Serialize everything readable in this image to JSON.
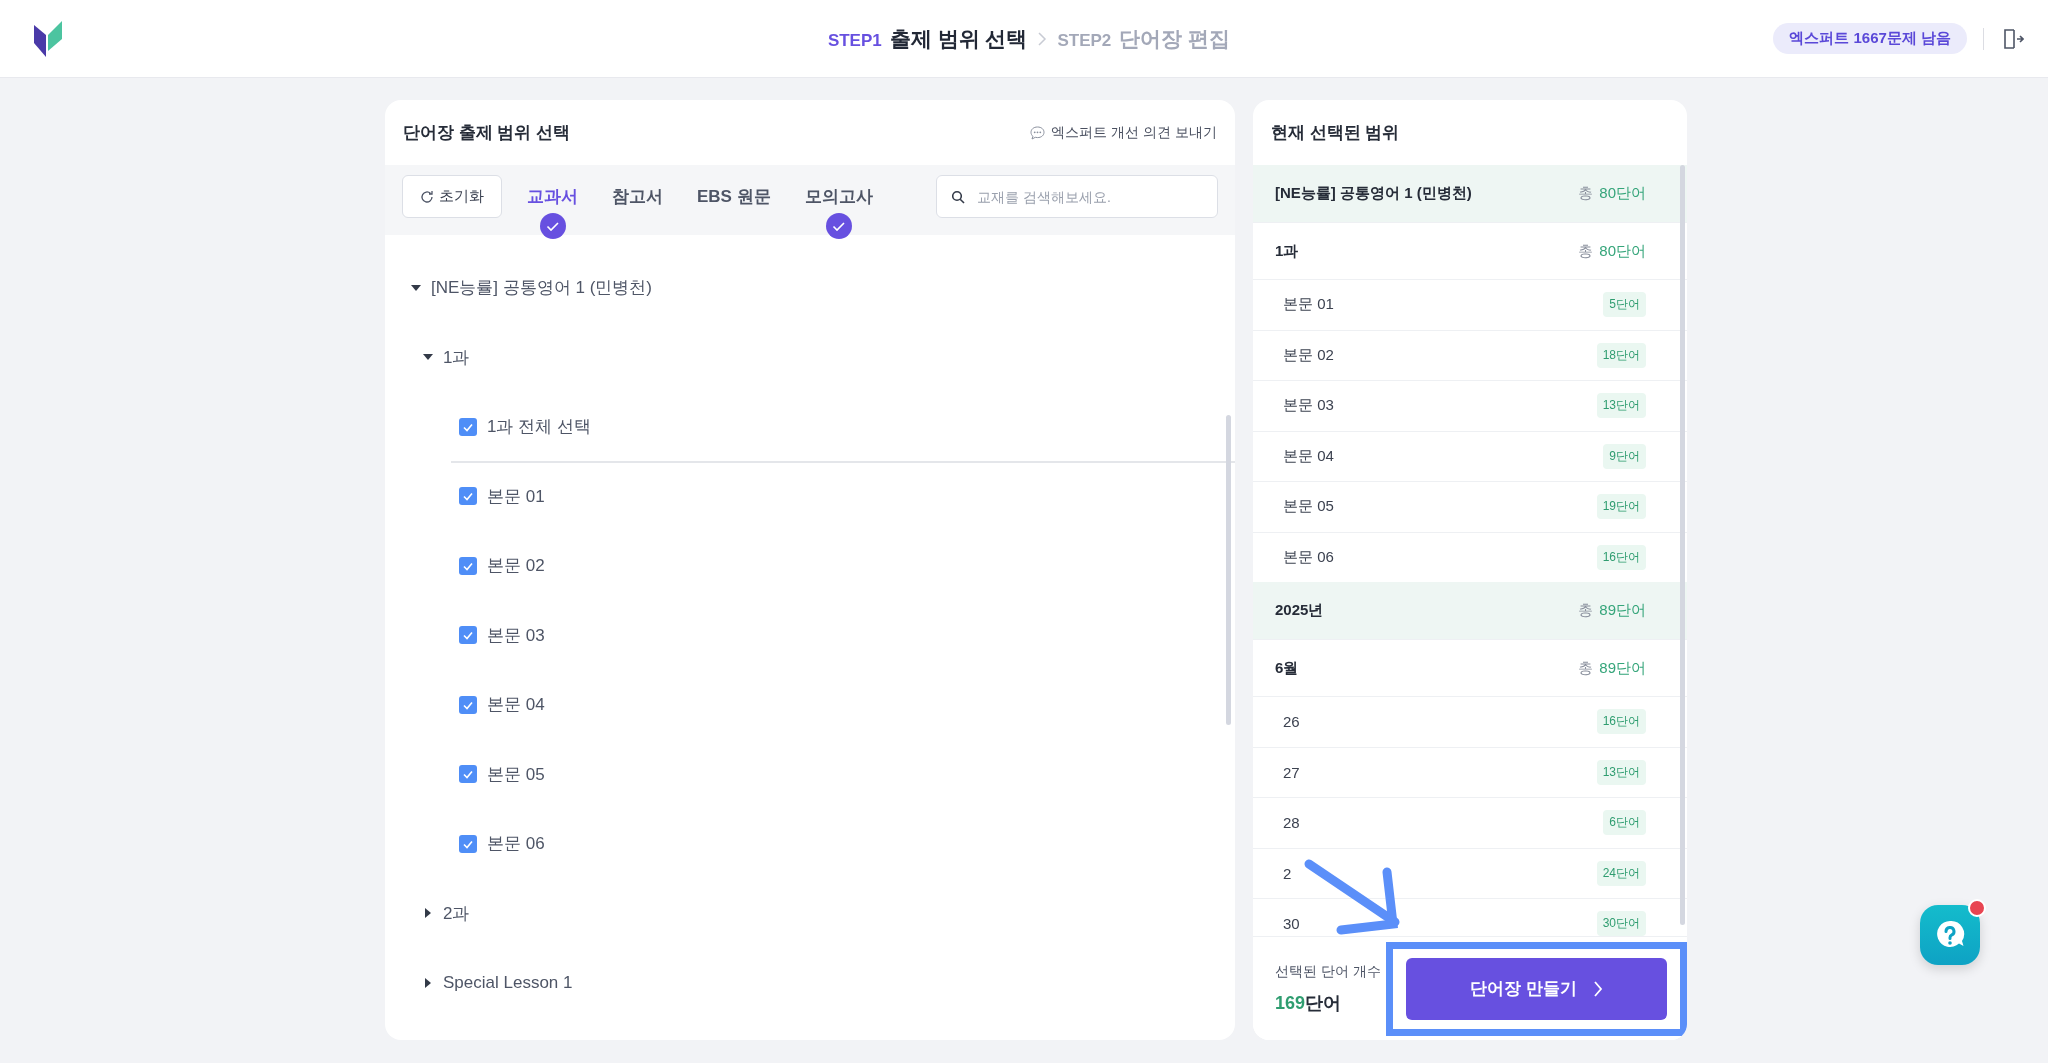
{
  "header": {
    "steps": [
      {
        "step": "STEP1",
        "label": "출제 범위 선택",
        "selected": true
      },
      {
        "step": "STEP2",
        "label": "단어장 편집",
        "selected": false
      }
    ],
    "remaining_badge": "엑스퍼트 1667문제 남음"
  },
  "scope_panel": {
    "title": "단어장 출제 범위 선택",
    "feedback_link": "엑스퍼트 개선 의견 보내기",
    "reset_button": "초기화",
    "tabs": [
      {
        "label": "교과서",
        "selected": true,
        "checked": true
      },
      {
        "label": "참고서",
        "selected": false,
        "checked": false
      },
      {
        "label": "EBS 원문",
        "selected": false,
        "checked": false
      },
      {
        "label": "모의고사",
        "selected": false,
        "checked": true
      }
    ],
    "search": {
      "placeholder": "교재를 검색해보세요."
    },
    "tree": [
      {
        "kind": "folder",
        "label": "[NE능률] 공통영어 1 (민병천)",
        "expanded": true,
        "children": [
          {
            "kind": "folder",
            "label": "1과",
            "expanded": true,
            "children": [
              {
                "kind": "checkbox",
                "label": "1과 전체 선택",
                "checked": true,
                "divider": true
              },
              {
                "kind": "checkbox",
                "label": "본문 01",
                "checked": true
              },
              {
                "kind": "checkbox",
                "label": "본문 02",
                "checked": true
              },
              {
                "kind": "checkbox",
                "label": "본문 03",
                "checked": true
              },
              {
                "kind": "checkbox",
                "label": "본문 04",
                "checked": true
              },
              {
                "kind": "checkbox",
                "label": "본문 05",
                "checked": true
              },
              {
                "kind": "checkbox",
                "label": "본문 06",
                "checked": true
              }
            ]
          },
          {
            "kind": "folder",
            "label": "2과",
            "expanded": false
          },
          {
            "kind": "folder",
            "label": "Special Lesson 1",
            "expanded": false
          }
        ]
      }
    ]
  },
  "selection_panel": {
    "title": "현재 선택된 범위",
    "rows": [
      {
        "kind": "group",
        "label": "[NE능률] 공통영어 1 (민병천)",
        "total_prefix": "총",
        "count": "80단어"
      },
      {
        "kind": "subgroup",
        "label": "1과",
        "total_prefix": "총",
        "count": "80단어"
      },
      {
        "kind": "item",
        "label": "본문 01",
        "count": "5단어"
      },
      {
        "kind": "item",
        "label": "본문 02",
        "count": "18단어"
      },
      {
        "kind": "item",
        "label": "본문 03",
        "count": "13단어"
      },
      {
        "kind": "item",
        "label": "본문 04",
        "count": "9단어"
      },
      {
        "kind": "item",
        "label": "본문 05",
        "count": "19단어"
      },
      {
        "kind": "item",
        "label": "본문 06",
        "count": "16단어"
      },
      {
        "kind": "group",
        "label": "2025년",
        "total_prefix": "총",
        "count": "89단어"
      },
      {
        "kind": "subgroup",
        "label": "6월",
        "total_prefix": "총",
        "count": "89단어"
      },
      {
        "kind": "item",
        "label": "26",
        "count": "16단어"
      },
      {
        "kind": "item",
        "label": "27",
        "count": "13단어"
      },
      {
        "kind": "item",
        "label": "28",
        "count": "6단어"
      },
      {
        "kind": "item",
        "label": "2",
        "count": "24단어"
      },
      {
        "kind": "item",
        "label": "30",
        "count": "30단어"
      }
    ],
    "footer": {
      "caption": "선택된 단어 개수",
      "count_number": "169",
      "count_unit": "단어",
      "create_button": "단어장 만들기"
    }
  }
}
